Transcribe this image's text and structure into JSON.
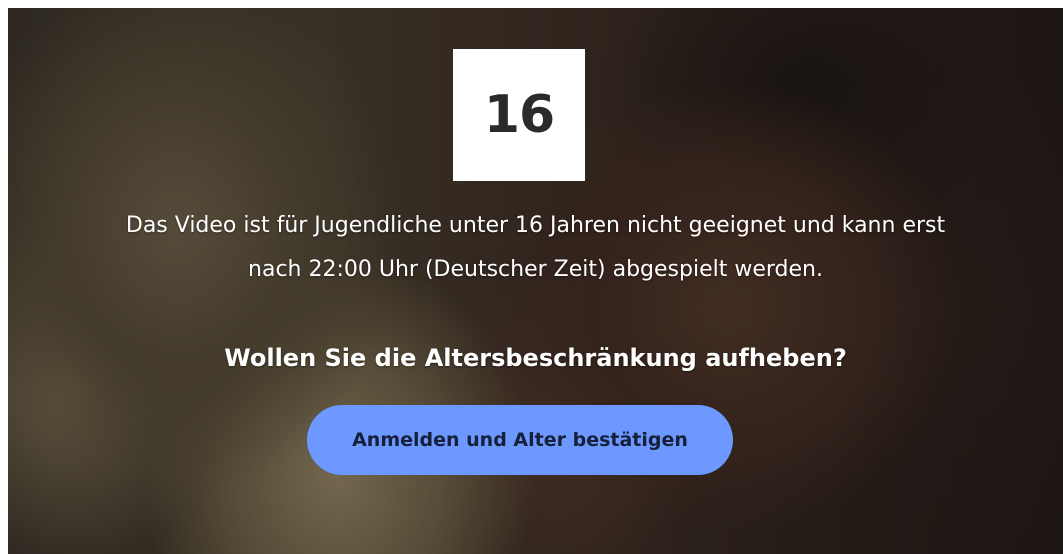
{
  "age_rating": {
    "value": "16"
  },
  "notice": {
    "line1": "Das Video ist für Jugendliche unter 16 Jahren nicht geeignet und kann erst",
    "line2": "nach 22:00 Uhr (Deutscher Zeit) abgespielt werden."
  },
  "question": {
    "text": "Wollen Sie die Altersbeschränkung aufheben?"
  },
  "actions": {
    "confirm_label": "Anmelden und Alter bestätigen"
  },
  "colors": {
    "button_background": "#6c98ff",
    "button_text": "#16203a",
    "rating_box_background": "#ffffff",
    "text": "#ffffff"
  }
}
